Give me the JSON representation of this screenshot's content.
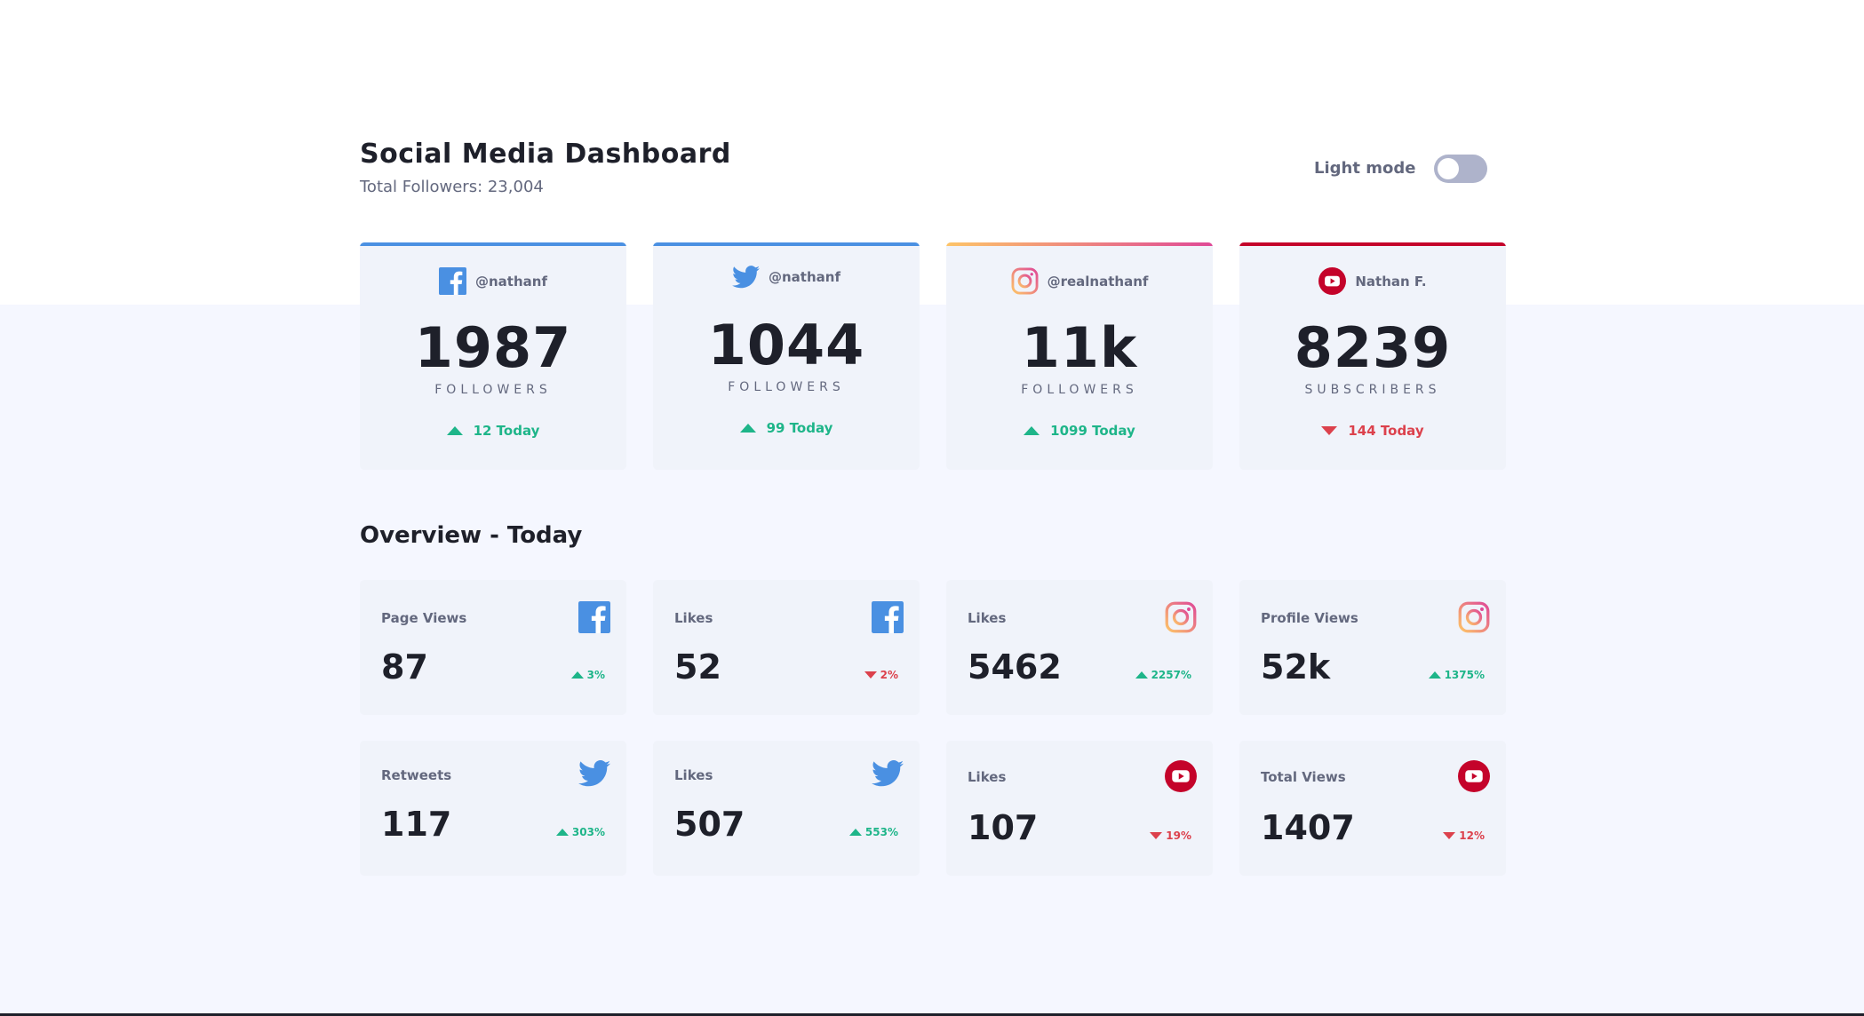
{
  "header": {
    "title": "Social Media Dashboard",
    "subtitle": "Total Followers: 23,004",
    "mode_label": "Light mode"
  },
  "colors": {
    "facebook": "#1877f2",
    "twitter": "#1da1f2",
    "instagram_start": "#fdc468",
    "instagram_end": "#df4996",
    "youtube": "#c4032a",
    "up": "#1eb589",
    "down": "#dc414c"
  },
  "followers": [
    {
      "platform": "facebook",
      "icon": "facebook-icon",
      "handle": "@nathanf",
      "count": "1987",
      "unit": "FOLLOWERS",
      "change": "12 Today",
      "direction": "up"
    },
    {
      "platform": "twitter",
      "icon": "twitter-icon",
      "handle": "@nathanf",
      "count": "1044",
      "unit": "FOLLOWERS",
      "change": "99 Today",
      "direction": "up"
    },
    {
      "platform": "instagram",
      "icon": "instagram-icon",
      "handle": "@realnathanf",
      "count": "11k",
      "unit": "FOLLOWERS",
      "change": "1099 Today",
      "direction": "up"
    },
    {
      "platform": "youtube",
      "icon": "youtube-icon",
      "handle": "Nathan F.",
      "count": "8239",
      "unit": "SUBSCRIBERS",
      "change": "144 Today",
      "direction": "down"
    }
  ],
  "overview_title": "Overview - Today",
  "overview": [
    {
      "label": "Page Views",
      "icon": "facebook-icon",
      "value": "87",
      "change": "3%",
      "direction": "up"
    },
    {
      "label": "Likes",
      "icon": "facebook-icon",
      "value": "52",
      "change": "2%",
      "direction": "down"
    },
    {
      "label": "Likes",
      "icon": "instagram-icon",
      "value": "5462",
      "change": "2257%",
      "direction": "up"
    },
    {
      "label": "Profile Views",
      "icon": "instagram-icon",
      "value": "52k",
      "change": "1375%",
      "direction": "up"
    },
    {
      "label": "Retweets",
      "icon": "twitter-icon",
      "value": "117",
      "change": "303%",
      "direction": "up"
    },
    {
      "label": "Likes",
      "icon": "twitter-icon",
      "value": "507",
      "change": "553%",
      "direction": "up"
    },
    {
      "label": "Likes",
      "icon": "youtube-icon",
      "value": "107",
      "change": "19%",
      "direction": "down"
    },
    {
      "label": "Total Views",
      "icon": "youtube-icon",
      "value": "1407",
      "change": "12%",
      "direction": "down"
    }
  ]
}
